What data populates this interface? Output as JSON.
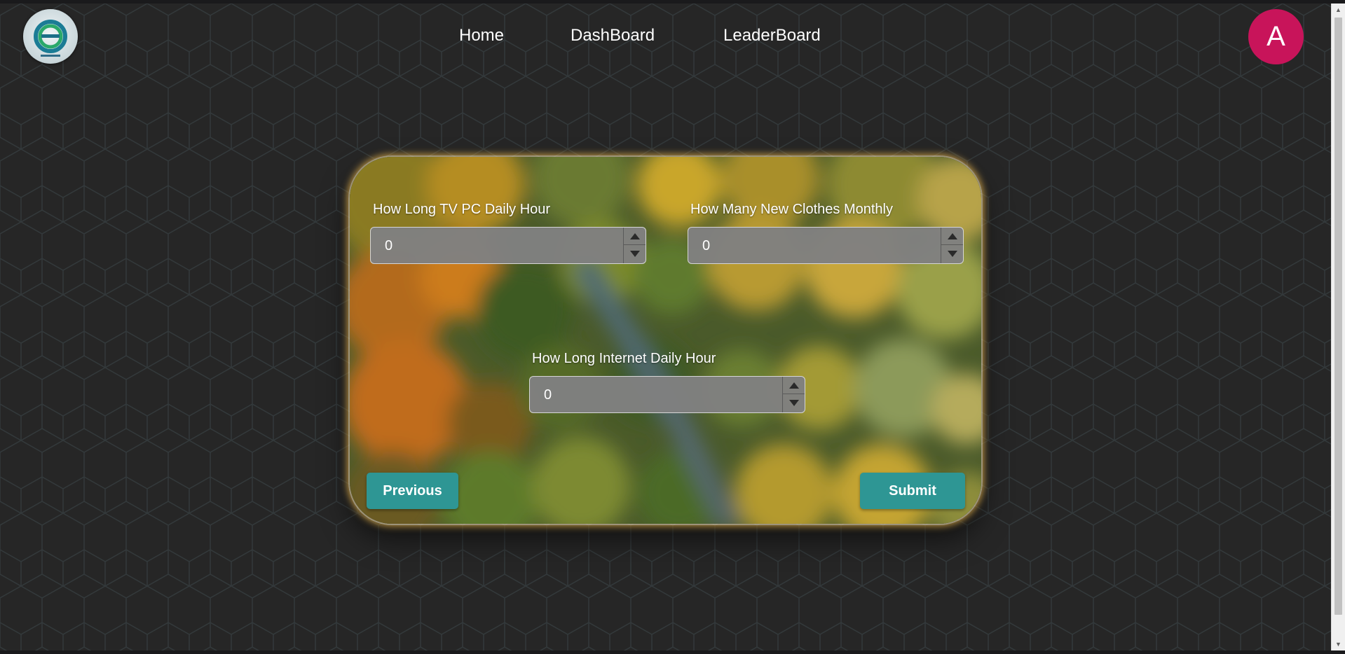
{
  "nav": {
    "logo_icon": "ecology-logo-icon",
    "links": [
      {
        "label": "Home"
      },
      {
        "label": "DashBoard"
      },
      {
        "label": "LeaderBoard"
      }
    ],
    "avatar_initial": "A"
  },
  "form": {
    "fields": [
      {
        "label": "How Long TV PC Daily Hour",
        "value": "0"
      },
      {
        "label": "How Many New Clothes Monthly",
        "value": "0"
      },
      {
        "label": "How Long Internet Daily Hour",
        "value": "0"
      }
    ],
    "previous_label": "Previous",
    "submit_label": "Submit"
  },
  "colors": {
    "page_background": "#262626",
    "button": "#2e9694",
    "avatar": "#c8145a",
    "card_glow": "#f4be50"
  }
}
